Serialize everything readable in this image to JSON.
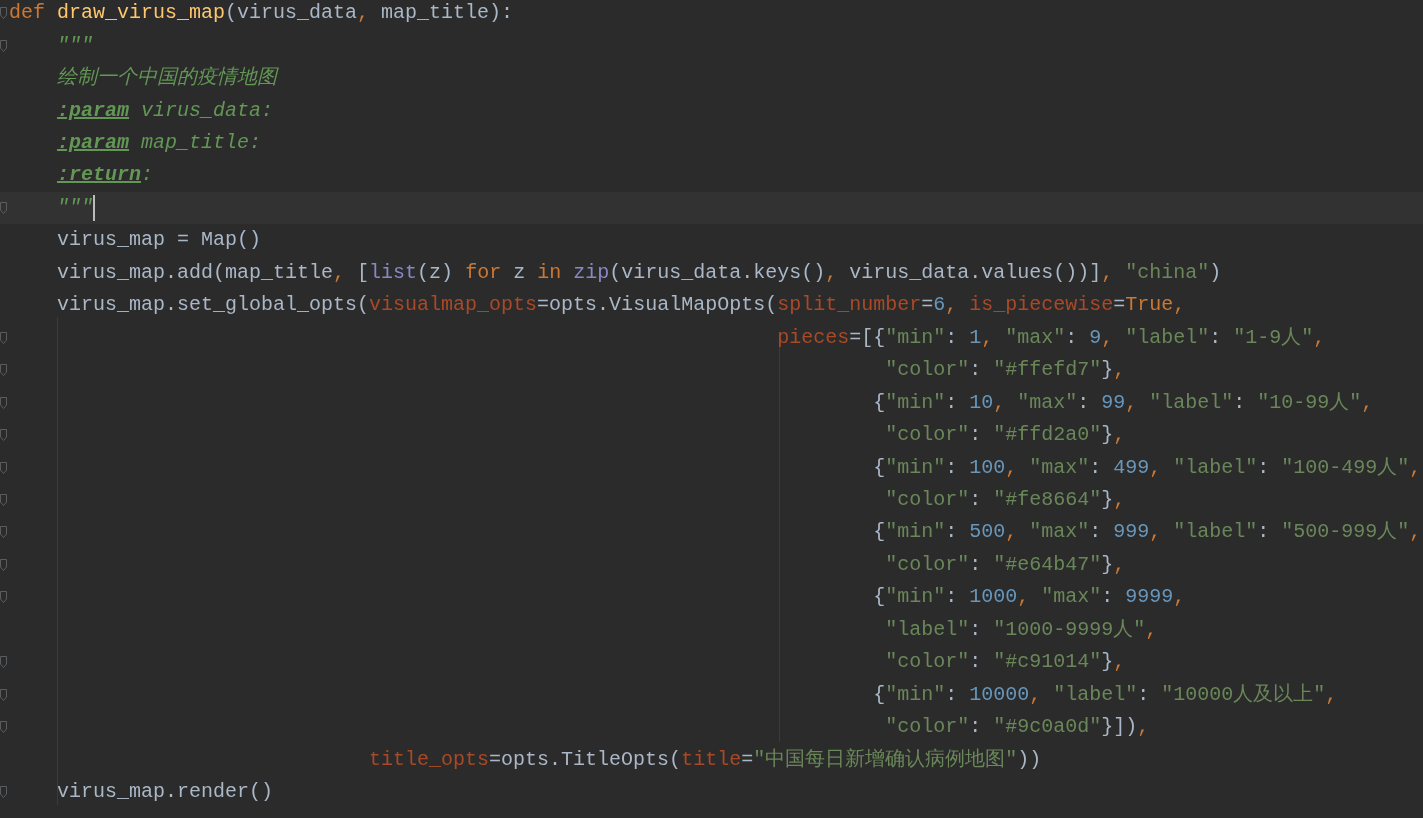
{
  "editor": {
    "lines": [
      {
        "fold_marker": true,
        "current": false,
        "tokens": [
          {
            "kind": "keyword",
            "text": "def "
          },
          {
            "kind": "function",
            "text": "draw_virus_map"
          },
          {
            "kind": "plain",
            "text": "(virus_data"
          },
          {
            "kind": "keyword",
            "text": ", "
          },
          {
            "kind": "plain",
            "text": "map_title):"
          }
        ]
      },
      {
        "fold_marker": true,
        "current": false,
        "tokens": [
          {
            "kind": "docstring",
            "text": "    \"\"\""
          }
        ]
      },
      {
        "fold_marker": false,
        "current": false,
        "tokens": [
          {
            "kind": "docstring",
            "text": "    绘制一个中国的疫情地图"
          }
        ]
      },
      {
        "fold_marker": false,
        "current": false,
        "tokens": [
          {
            "kind": "doctag",
            "text": "    :param"
          },
          {
            "kind": "docstring",
            "text": " virus_data:"
          }
        ]
      },
      {
        "fold_marker": false,
        "current": false,
        "tokens": [
          {
            "kind": "doctag",
            "text": "    :param"
          },
          {
            "kind": "docstring",
            "text": " map_title:"
          }
        ]
      },
      {
        "fold_marker": false,
        "current": false,
        "tokens": [
          {
            "kind": "doctag",
            "text": "    :return"
          },
          {
            "kind": "docstring",
            "text": ":"
          }
        ]
      },
      {
        "fold_marker": true,
        "current": true,
        "tokens": [
          {
            "kind": "docstring",
            "text": "    \"\"\""
          }
        ]
      },
      {
        "fold_marker": false,
        "current": false,
        "tokens": [
          {
            "kind": "plain",
            "text": "    virus_map = Map()"
          }
        ]
      },
      {
        "fold_marker": false,
        "current": false,
        "tokens": [
          {
            "kind": "plain",
            "text": "    virus_map.add(map_title"
          },
          {
            "kind": "keyword",
            "text": ", "
          },
          {
            "kind": "plain",
            "text": "["
          },
          {
            "kind": "builtin",
            "text": "list"
          },
          {
            "kind": "plain",
            "text": "(z) "
          },
          {
            "kind": "keyword",
            "text": "for"
          },
          {
            "kind": "plain",
            "text": " z "
          },
          {
            "kind": "keyword",
            "text": "in "
          },
          {
            "kind": "builtin",
            "text": "zip"
          },
          {
            "kind": "plain",
            "text": "(virus_data.keys()"
          },
          {
            "kind": "keyword",
            "text": ", "
          },
          {
            "kind": "plain",
            "text": "virus_data.values())]"
          },
          {
            "kind": "keyword",
            "text": ", "
          },
          {
            "kind": "string",
            "text": "\"china\""
          },
          {
            "kind": "plain",
            "text": ")"
          }
        ]
      },
      {
        "fold_marker": false,
        "current": false,
        "tokens": [
          {
            "kind": "plain",
            "text": "    virus_map.set_global_opts("
          },
          {
            "kind": "argument",
            "text": "visualmap_opts"
          },
          {
            "kind": "plain",
            "text": "=opts.VisualMapOpts("
          },
          {
            "kind": "argument",
            "text": "split_number"
          },
          {
            "kind": "plain",
            "text": "="
          },
          {
            "kind": "number",
            "text": "6"
          },
          {
            "kind": "keyword",
            "text": ", "
          },
          {
            "kind": "argument",
            "text": "is_piecewise"
          },
          {
            "kind": "plain",
            "text": "="
          },
          {
            "kind": "keyword",
            "text": "True,"
          }
        ]
      },
      {
        "fold_marker": true,
        "current": false,
        "tokens": [
          {
            "kind": "argument",
            "text": "                                                                pieces"
          },
          {
            "kind": "plain",
            "text": "=[{"
          },
          {
            "kind": "string",
            "text": "\"min\""
          },
          {
            "kind": "plain",
            "text": ": "
          },
          {
            "kind": "number",
            "text": "1"
          },
          {
            "kind": "keyword",
            "text": ", "
          },
          {
            "kind": "string",
            "text": "\"max\""
          },
          {
            "kind": "plain",
            "text": ": "
          },
          {
            "kind": "number",
            "text": "9"
          },
          {
            "kind": "keyword",
            "text": ", "
          },
          {
            "kind": "string",
            "text": "\"label\""
          },
          {
            "kind": "plain",
            "text": ": "
          },
          {
            "kind": "string",
            "text": "\"1-9人\""
          },
          {
            "kind": "keyword",
            "text": ","
          }
        ]
      },
      {
        "fold_marker": true,
        "current": false,
        "tokens": [
          {
            "kind": "string",
            "text": "                                                                         \"color\""
          },
          {
            "kind": "plain",
            "text": ": "
          },
          {
            "kind": "string",
            "text": "\"#ffefd7\""
          },
          {
            "kind": "plain",
            "text": "}"
          },
          {
            "kind": "keyword",
            "text": ","
          }
        ]
      },
      {
        "fold_marker": true,
        "current": false,
        "tokens": [
          {
            "kind": "plain",
            "text": "                                                                        {"
          },
          {
            "kind": "string",
            "text": "\"min\""
          },
          {
            "kind": "plain",
            "text": ": "
          },
          {
            "kind": "number",
            "text": "10"
          },
          {
            "kind": "keyword",
            "text": ", "
          },
          {
            "kind": "string",
            "text": "\"max\""
          },
          {
            "kind": "plain",
            "text": ": "
          },
          {
            "kind": "number",
            "text": "99"
          },
          {
            "kind": "keyword",
            "text": ", "
          },
          {
            "kind": "string",
            "text": "\"label\""
          },
          {
            "kind": "plain",
            "text": ": "
          },
          {
            "kind": "string",
            "text": "\"10-99人\""
          },
          {
            "kind": "keyword",
            "text": ","
          }
        ]
      },
      {
        "fold_marker": true,
        "current": false,
        "tokens": [
          {
            "kind": "string",
            "text": "                                                                         \"color\""
          },
          {
            "kind": "plain",
            "text": ": "
          },
          {
            "kind": "string",
            "text": "\"#ffd2a0\""
          },
          {
            "kind": "plain",
            "text": "}"
          },
          {
            "kind": "keyword",
            "text": ","
          }
        ]
      },
      {
        "fold_marker": true,
        "current": false,
        "tokens": [
          {
            "kind": "plain",
            "text": "                                                                        {"
          },
          {
            "kind": "string",
            "text": "\"min\""
          },
          {
            "kind": "plain",
            "text": ": "
          },
          {
            "kind": "number",
            "text": "100"
          },
          {
            "kind": "keyword",
            "text": ", "
          },
          {
            "kind": "string",
            "text": "\"max\""
          },
          {
            "kind": "plain",
            "text": ": "
          },
          {
            "kind": "number",
            "text": "499"
          },
          {
            "kind": "keyword",
            "text": ", "
          },
          {
            "kind": "string",
            "text": "\"label\""
          },
          {
            "kind": "plain",
            "text": ": "
          },
          {
            "kind": "string",
            "text": "\"100-499人\""
          },
          {
            "kind": "keyword",
            "text": ","
          }
        ]
      },
      {
        "fold_marker": true,
        "current": false,
        "tokens": [
          {
            "kind": "string",
            "text": "                                                                         \"color\""
          },
          {
            "kind": "plain",
            "text": ": "
          },
          {
            "kind": "string",
            "text": "\"#fe8664\""
          },
          {
            "kind": "plain",
            "text": "}"
          },
          {
            "kind": "keyword",
            "text": ","
          }
        ]
      },
      {
        "fold_marker": true,
        "current": false,
        "tokens": [
          {
            "kind": "plain",
            "text": "                                                                        {"
          },
          {
            "kind": "string",
            "text": "\"min\""
          },
          {
            "kind": "plain",
            "text": ": "
          },
          {
            "kind": "number",
            "text": "500"
          },
          {
            "kind": "keyword",
            "text": ", "
          },
          {
            "kind": "string",
            "text": "\"max\""
          },
          {
            "kind": "plain",
            "text": ": "
          },
          {
            "kind": "number",
            "text": "999"
          },
          {
            "kind": "keyword",
            "text": ", "
          },
          {
            "kind": "string",
            "text": "\"label\""
          },
          {
            "kind": "plain",
            "text": ": "
          },
          {
            "kind": "string",
            "text": "\"500-999人\""
          },
          {
            "kind": "keyword",
            "text": ","
          }
        ]
      },
      {
        "fold_marker": true,
        "current": false,
        "tokens": [
          {
            "kind": "string",
            "text": "                                                                         \"color\""
          },
          {
            "kind": "plain",
            "text": ": "
          },
          {
            "kind": "string",
            "text": "\"#e64b47\""
          },
          {
            "kind": "plain",
            "text": "}"
          },
          {
            "kind": "keyword",
            "text": ","
          }
        ]
      },
      {
        "fold_marker": true,
        "current": false,
        "tokens": [
          {
            "kind": "plain",
            "text": "                                                                        {"
          },
          {
            "kind": "string",
            "text": "\"min\""
          },
          {
            "kind": "plain",
            "text": ": "
          },
          {
            "kind": "number",
            "text": "1000"
          },
          {
            "kind": "keyword",
            "text": ", "
          },
          {
            "kind": "string",
            "text": "\"max\""
          },
          {
            "kind": "plain",
            "text": ": "
          },
          {
            "kind": "number",
            "text": "9999"
          },
          {
            "kind": "keyword",
            "text": ","
          }
        ]
      },
      {
        "fold_marker": false,
        "current": false,
        "tokens": [
          {
            "kind": "string",
            "text": "                                                                         \"label\""
          },
          {
            "kind": "plain",
            "text": ": "
          },
          {
            "kind": "string",
            "text": "\"1000-9999人\""
          },
          {
            "kind": "keyword",
            "text": ","
          }
        ]
      },
      {
        "fold_marker": true,
        "current": false,
        "tokens": [
          {
            "kind": "string",
            "text": "                                                                         \"color\""
          },
          {
            "kind": "plain",
            "text": ": "
          },
          {
            "kind": "string",
            "text": "\"#c91014\""
          },
          {
            "kind": "plain",
            "text": "}"
          },
          {
            "kind": "keyword",
            "text": ","
          }
        ]
      },
      {
        "fold_marker": true,
        "current": false,
        "tokens": [
          {
            "kind": "plain",
            "text": "                                                                        {"
          },
          {
            "kind": "string",
            "text": "\"min\""
          },
          {
            "kind": "plain",
            "text": ": "
          },
          {
            "kind": "number",
            "text": "10000"
          },
          {
            "kind": "keyword",
            "text": ", "
          },
          {
            "kind": "string",
            "text": "\"label\""
          },
          {
            "kind": "plain",
            "text": ": "
          },
          {
            "kind": "string",
            "text": "\"10000人及以上\""
          },
          {
            "kind": "keyword",
            "text": ","
          }
        ]
      },
      {
        "fold_marker": true,
        "current": false,
        "tokens": [
          {
            "kind": "string",
            "text": "                                                                         \"color\""
          },
          {
            "kind": "plain",
            "text": ": "
          },
          {
            "kind": "string",
            "text": "\"#9c0a0d\""
          },
          {
            "kind": "plain",
            "text": "}])"
          },
          {
            "kind": "keyword",
            "text": ","
          }
        ]
      },
      {
        "fold_marker": false,
        "current": false,
        "tokens": [
          {
            "kind": "argument",
            "text": "                              title_opts"
          },
          {
            "kind": "plain",
            "text": "=opts.TitleOpts("
          },
          {
            "kind": "argument",
            "text": "title"
          },
          {
            "kind": "plain",
            "text": "="
          },
          {
            "kind": "string",
            "text": "\"中国每日新增确认病例地图\""
          },
          {
            "kind": "plain",
            "text": "))"
          }
        ]
      },
      {
        "fold_marker": true,
        "current": false,
        "tokens": [
          {
            "kind": "plain",
            "text": "    virus_map.render()"
          }
        ]
      }
    ]
  }
}
